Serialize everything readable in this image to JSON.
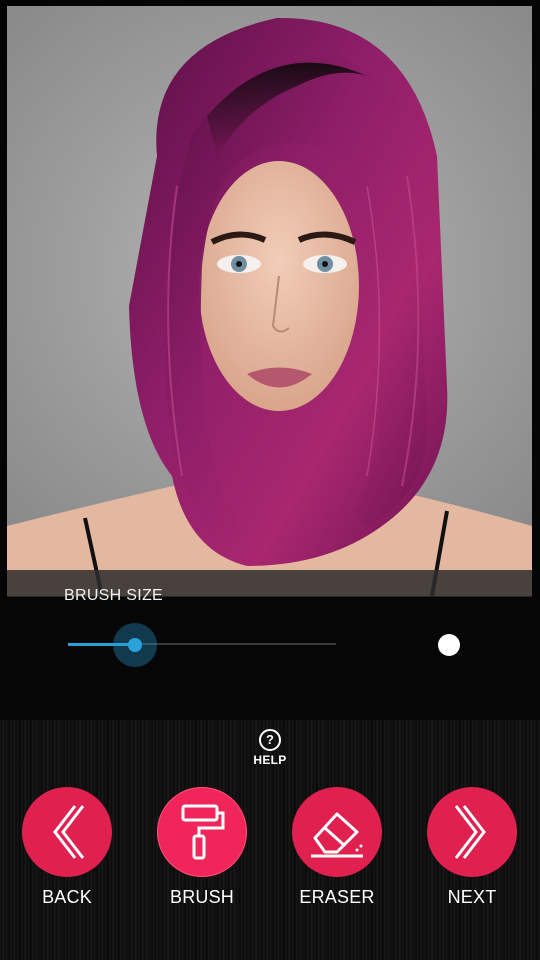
{
  "brush": {
    "label": "BRUSH SIZE",
    "size_fraction": 0.25
  },
  "help": {
    "icon": "?",
    "label": "HELP"
  },
  "tools": {
    "back": {
      "label": "BACK",
      "icon": "chevron-left-icon"
    },
    "brush": {
      "label": "BRUSH",
      "icon": "paint-roller-icon"
    },
    "eraser": {
      "label": "ERASER",
      "icon": "eraser-icon"
    },
    "next": {
      "label": "NEXT",
      "icon": "chevron-right-icon"
    }
  },
  "colors": {
    "accent": "#e0204f",
    "slider": "#2a9fd6",
    "hair": "#8a1a62"
  }
}
